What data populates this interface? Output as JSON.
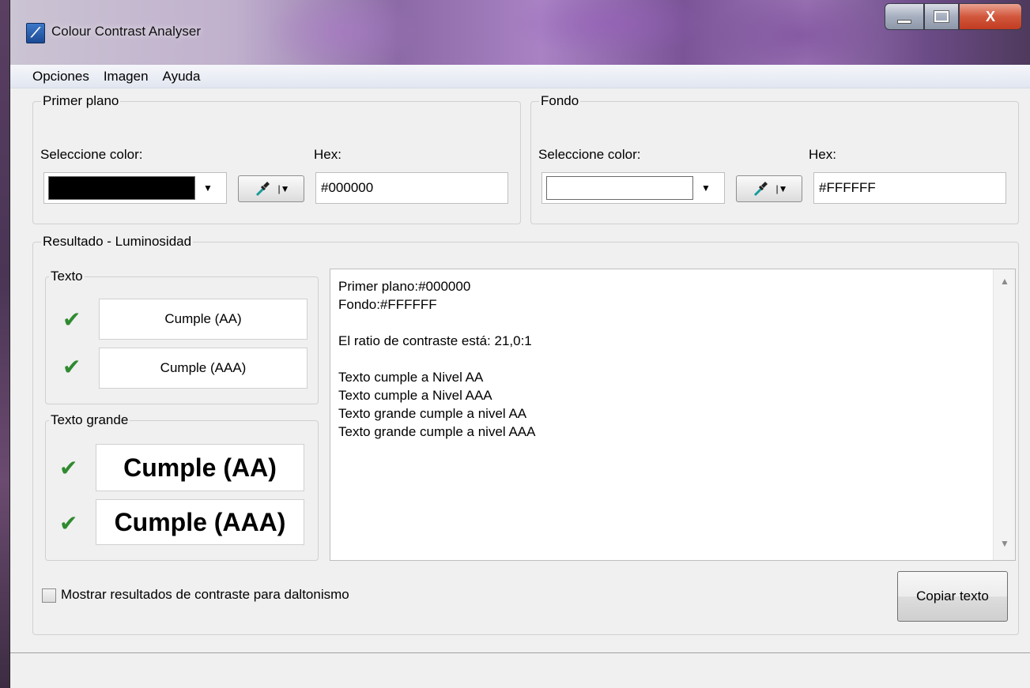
{
  "window": {
    "title": "Colour Contrast Analyser",
    "icon": "app-icon",
    "controls": {
      "minimize_icon": "minimize-icon",
      "maximize_icon": "maximize-icon",
      "close_label": "X"
    }
  },
  "menubar": {
    "items": [
      "Opciones",
      "Imagen",
      "Ayuda"
    ]
  },
  "foreground": {
    "legend": "Primer plano",
    "select_label": "Seleccione color:",
    "hex_label": "Hex:",
    "swatch_color": "#000000",
    "hex_value": "#000000",
    "picker_icon": "eyedropper-icon"
  },
  "background": {
    "legend": "Fondo",
    "select_label": "Seleccione color:",
    "hex_label": "Hex:",
    "swatch_color": "#FFFFFF",
    "hex_value": "#FFFFFF",
    "picker_icon": "eyedropper-icon"
  },
  "results": {
    "legend": "Resultado - Luminosidad",
    "text_group": {
      "legend": "Texto",
      "aa": "Cumple (AA)",
      "aaa": "Cumple (AAA)"
    },
    "large_text_group": {
      "legend": "Texto grande",
      "aa": "Cumple (AA)",
      "aaa": "Cumple (AAA)"
    },
    "pass_icon": "check-icon",
    "pass_color": "#2f8a2f",
    "report_lines": [
      "Primer plano:#000000",
      "Fondo:#FFFFFF",
      "",
      "El ratio de contraste está: 21,0:1",
      "",
      "Texto cumple a Nivel AA",
      "Texto cumple a Nivel AAA",
      "Texto grande cumple a nivel AA",
      "Texto grande cumple a nivel AAA"
    ]
  },
  "colorblind_checkbox": {
    "label": "Mostrar resultados de contraste para daltonismo",
    "checked": false
  },
  "copy_button": {
    "label": "Copiar texto"
  }
}
